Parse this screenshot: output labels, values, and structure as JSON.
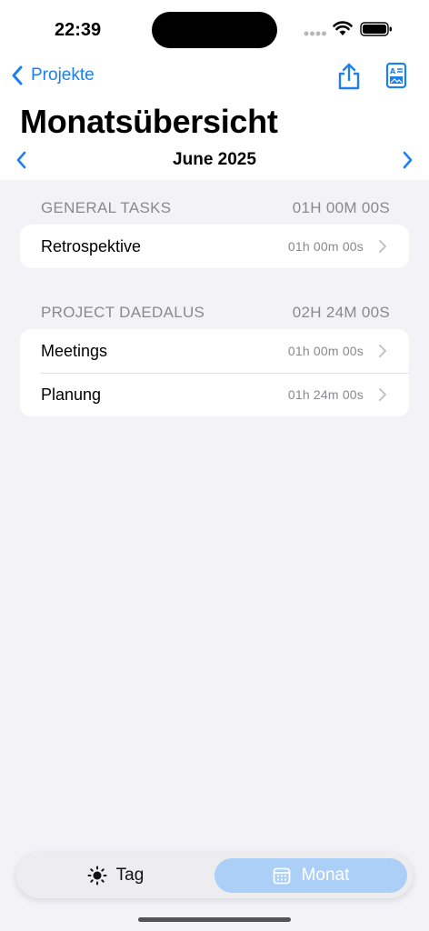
{
  "status_bar": {
    "time": "22:39"
  },
  "nav": {
    "back_label": "Projekte"
  },
  "page": {
    "title": "Monatsübersicht",
    "month": "June 2025"
  },
  "sections": [
    {
      "title": "GENERAL TASKS",
      "total": "01H 00M 00S",
      "items": [
        {
          "name": "Retrospektive",
          "duration": "01h 00m 00s"
        }
      ]
    },
    {
      "title": "PROJECT DAEDALUS",
      "total": "02H 24M 00S",
      "items": [
        {
          "name": "Meetings",
          "duration": "01h 00m 00s"
        },
        {
          "name": "Planung",
          "duration": "01h 24m 00s"
        }
      ]
    }
  ],
  "tabbar": {
    "day_label": "Tag",
    "month_label": "Monat",
    "selected": "Monat"
  },
  "colors": {
    "accent": "#1d7ff0",
    "background": "#f2f2f7",
    "secondary_text": "#8a8a8e",
    "selected_tab": "#abcff7"
  },
  "icons": {
    "share": "share-icon",
    "report": "report-icon",
    "day": "sun-icon",
    "month": "calendar-icon"
  }
}
